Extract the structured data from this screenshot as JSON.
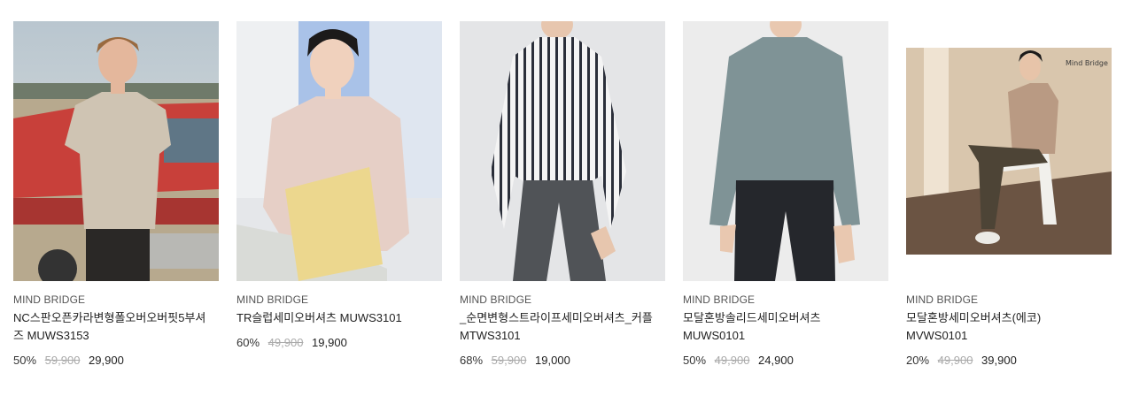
{
  "products": [
    {
      "image": "man-polo-shirt-red-truck-photo",
      "brand": "MIND BRIDGE",
      "name": "NC스판오픈카라변형폴오버오버핏5부셔즈 MUWS3153",
      "discount": "50%",
      "original_price": "59,900",
      "sale_price": "29,900"
    },
    {
      "image": "man-pink-shirt-holding-folder-photo",
      "brand": "MIND BRIDGE",
      "name": "TR슬럽세미오버셔츠 MUWS3101",
      "discount": "60%",
      "original_price": "49,900",
      "sale_price": "19,900"
    },
    {
      "image": "man-striped-shirt-photo",
      "brand": "MIND BRIDGE",
      "name": "_순면변형스트라이프세미오버셔츠_커플 MTWS3101",
      "discount": "68%",
      "original_price": "59,900",
      "sale_price": "19,000"
    },
    {
      "image": "man-blue-gray-shirt-photo",
      "brand": "MIND BRIDGE",
      "name": "모달혼방솔리드세미오버셔츠 MUWS0101",
      "discount": "50%",
      "original_price": "49,900",
      "sale_price": "24,900"
    },
    {
      "image": "man-beige-shirt-seated-photo",
      "image_watermark": "Mind Bridge",
      "brand": "MIND BRIDGE",
      "name": "모달혼방세미오버셔츠(에코) MVWS0101",
      "discount": "20%",
      "original_price": "49,900",
      "sale_price": "39,900"
    }
  ]
}
